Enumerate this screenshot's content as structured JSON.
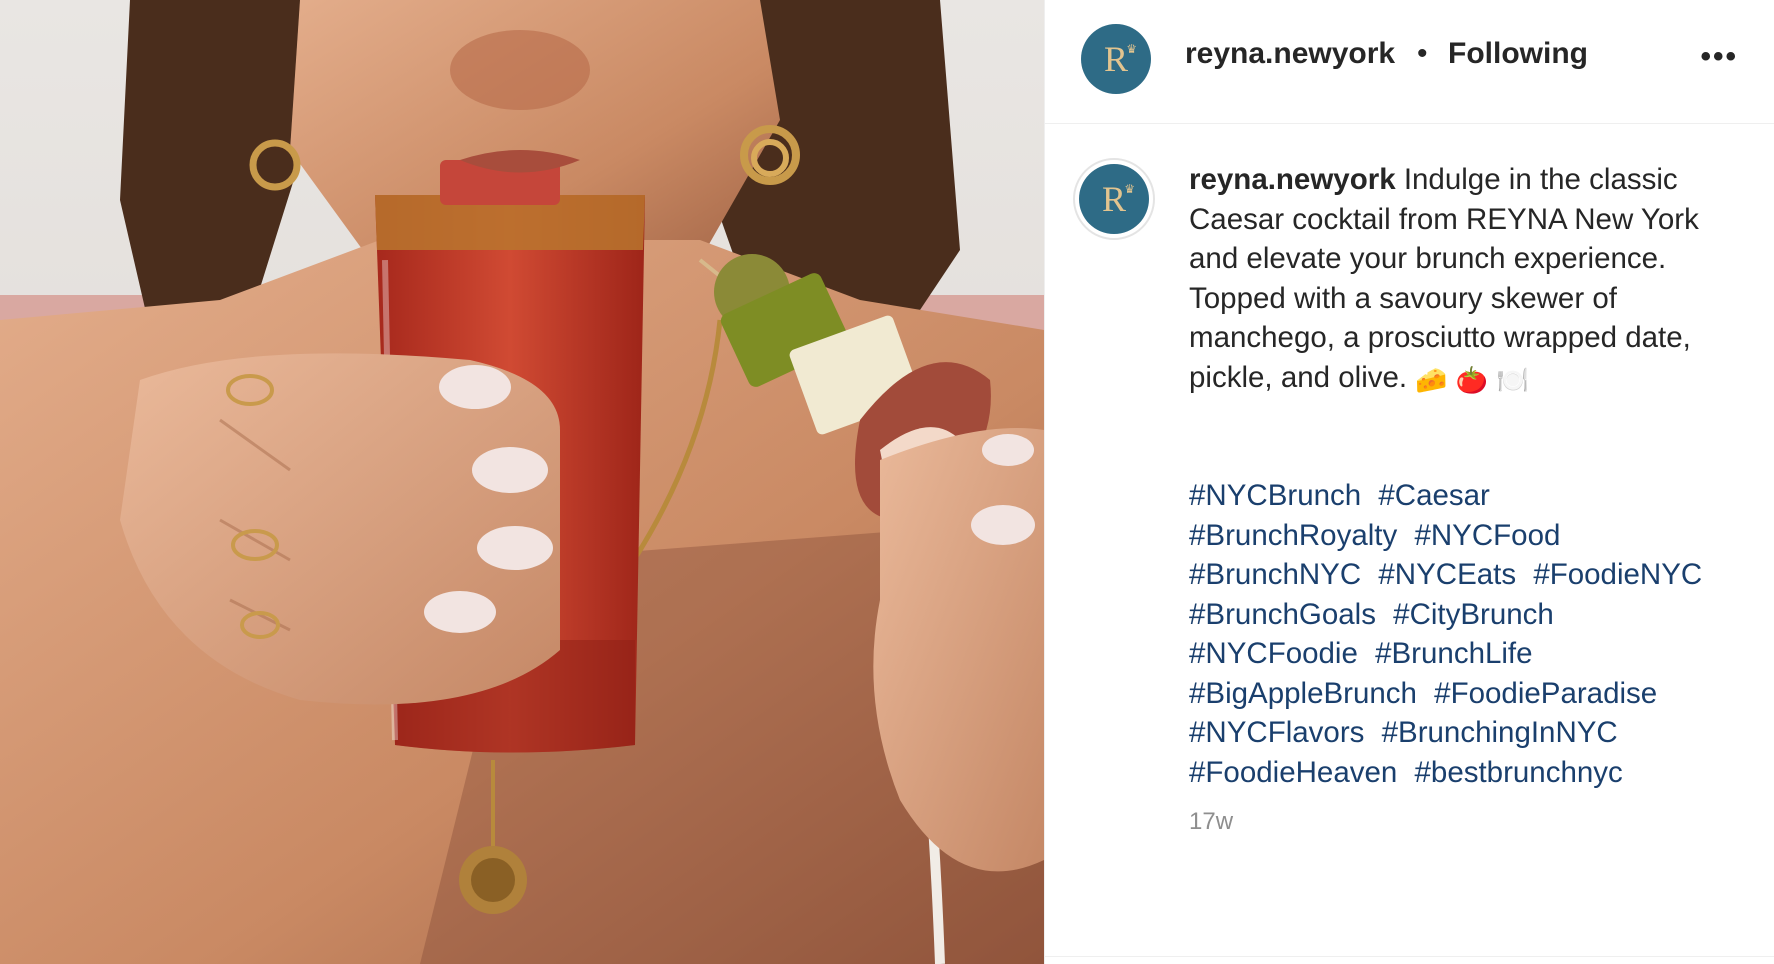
{
  "post": {
    "username": "reyna.newyork",
    "follow_status": "Following",
    "separator": "•",
    "more_label": "•••",
    "avatar_letter": "R",
    "avatar_crown": "♛",
    "caption_text": "Indulge in the classic Caesar cocktail from REYNA New York and elevate your brunch experience. Topped with a savoury skewer of manchego, a prosciutto wrapped date, pickle, and olive.",
    "caption_emojis": [
      "🧀",
      "🍅",
      "🍽️"
    ],
    "hashtags": [
      "#NYCBrunch",
      "#Caesar",
      "#BrunchRoyalty",
      "#NYCFood",
      "#BrunchNYC",
      "#NYCEats",
      "#FoodieNYC",
      "#BrunchGoals",
      "#CityBrunch",
      "#NYCFoodie",
      "#BrunchLife",
      "#BigAppleBrunch",
      "#FoodieParadise",
      "#NYCFlavors",
      "#BrunchingInNYC",
      "#FoodieHeaven",
      "#bestbrunchnyc"
    ],
    "timestamp": "17w"
  },
  "colors": {
    "hashtag": "#1a3f6d",
    "avatar_bg": "#2e6b86",
    "avatar_fg": "#e2c48f",
    "muted": "#8e8e8e"
  }
}
